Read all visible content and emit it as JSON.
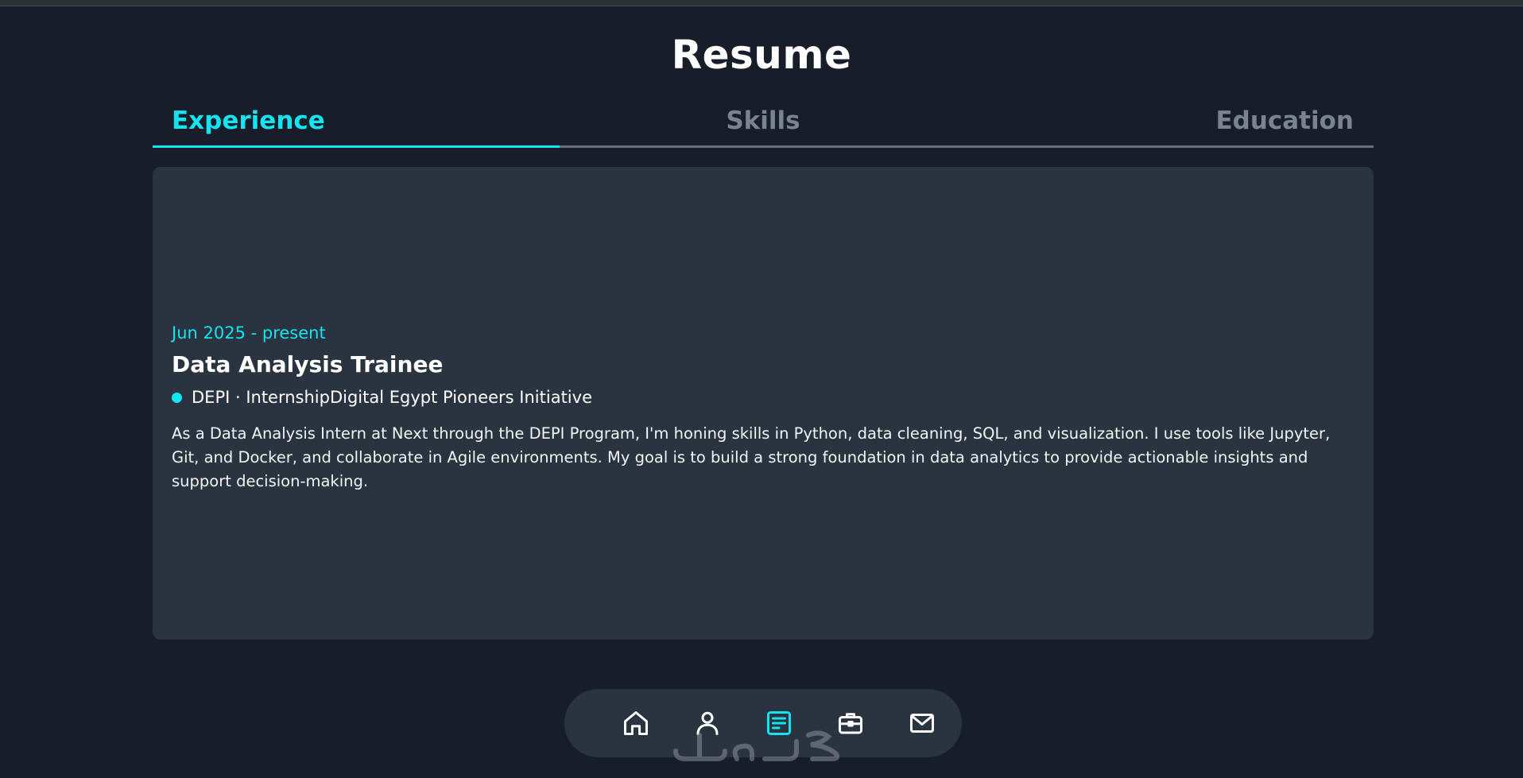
{
  "page": {
    "title": "Resume"
  },
  "tabs": [
    {
      "label": "Experience",
      "active": true
    },
    {
      "label": "Skills",
      "active": false
    },
    {
      "label": "Education",
      "active": false
    }
  ],
  "experience": {
    "date": "Jun 2025 - present",
    "title": "Data Analysis Trainee",
    "company": "DEPI · InternshipDigital Egypt Pioneers Initiative",
    "description": "As a Data Analysis Intern at Next through the DEPI Program, I'm honing skills in Python, data cleaning, SQL, and visualization. I use tools like Jupyter, Git, and Docker, and collaborate in Agile environments. My goal is to build a strong foundation in data analytics to provide actionable insights and support decision-making."
  },
  "dock": {
    "items": [
      {
        "icon": "home-icon",
        "active": false
      },
      {
        "icon": "user-icon",
        "active": false
      },
      {
        "icon": "resume-icon",
        "active": true
      },
      {
        "icon": "briefcase-icon",
        "active": false
      },
      {
        "icon": "mail-icon",
        "active": false
      }
    ]
  },
  "colors": {
    "accent": "#14e3f0",
    "background": "#171d29",
    "card": "#2a3440",
    "muted": "#7b8290"
  }
}
